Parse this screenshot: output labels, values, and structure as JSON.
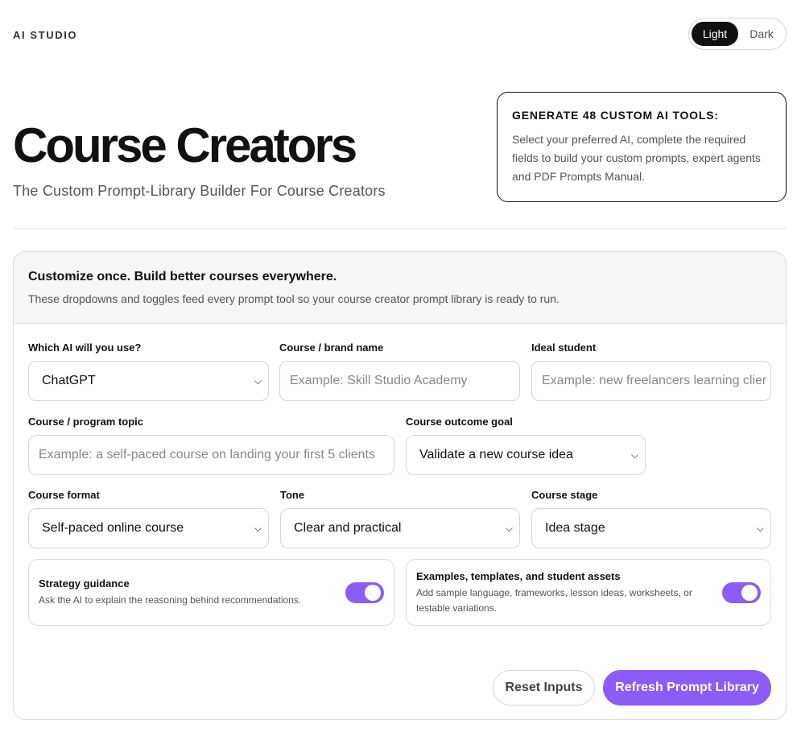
{
  "header": {
    "brand": "AI STUDIO",
    "theme": {
      "light_label": "Light",
      "dark_label": "Dark",
      "selected": "Light"
    }
  },
  "hero": {
    "title": "Course Creators",
    "subtitle": "The Custom Prompt-Library Builder For Course Creators"
  },
  "generate_box": {
    "title": "GENERATE 48 CUSTOM AI TOOLS:",
    "text": "Select your preferred AI, complete the required fields to build your custom prompts, expert agents and PDF Prompts Manual."
  },
  "form": {
    "title": "Customize once. Build better courses everywhere.",
    "description": "These dropdowns and toggles feed every prompt tool so your course creator prompt library is ready to run.",
    "fields": {
      "ai": {
        "label": "Which AI will you use?",
        "value": "ChatGPT"
      },
      "brand": {
        "label": "Course / brand name",
        "placeholder": "Example: Skill Studio Academy"
      },
      "student": {
        "label": "Ideal student",
        "placeholder": "Example: new freelancers learning clier"
      },
      "topic": {
        "label": "Course / program topic",
        "placeholder": "Example: a self-paced course on landing your first 5 clients"
      },
      "goal": {
        "label": "Course outcome goal",
        "value": "Validate a new course idea"
      },
      "format": {
        "label": "Course format",
        "value": "Self-paced online course"
      },
      "tone": {
        "label": "Tone",
        "value": "Clear and practical"
      },
      "stage": {
        "label": "Course stage",
        "value": "Idea stage"
      }
    },
    "toggles": {
      "strategy": {
        "title": "Strategy guidance",
        "description": "Ask the AI to explain the reasoning behind recommendations.",
        "on": true
      },
      "examples": {
        "title": "Examples, templates, and student assets",
        "description": "Add sample language, frameworks, lesson ideas, worksheets, or testable variations.",
        "on": true
      }
    },
    "buttons": {
      "reset": "Reset Inputs",
      "refresh": "Refresh Prompt Library"
    }
  },
  "colors": {
    "accent": "#8b5cf6",
    "text": "#111111",
    "muted": "#555555"
  },
  "icons": {
    "select_arrow": "chevron-down-icon"
  }
}
